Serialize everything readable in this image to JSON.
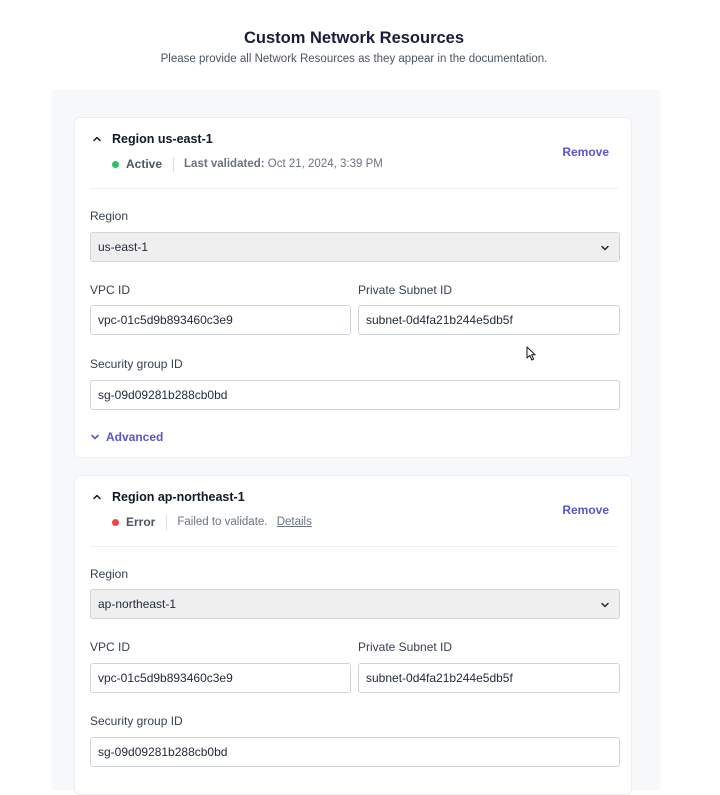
{
  "header": {
    "title": "Custom Network Resources",
    "subtitle": "Please provide all Network Resources as they appear in the documentation."
  },
  "colors": {
    "accent": "#5856c9",
    "status_active": "#22c55e",
    "status_error": "#ef4444"
  },
  "regions": [
    {
      "title": "Region us-east-1",
      "status": "Active",
      "status_color": "#22c55e",
      "last_validated_label": "Last validated:",
      "last_validated_value": "Oct 21, 2024, 3:39 PM",
      "remove_label": "Remove",
      "region_label": "Region",
      "region_value": "us-east-1",
      "vpc_label": "VPC ID",
      "vpc_value": "vpc-01c5d9b893460c3e9",
      "subnet_label": "Private Subnet ID",
      "subnet_value": "subnet-0d4fa21b244e5db5f",
      "sg_label": "Security group ID",
      "sg_value": "sg-09d09281b288cb0bd",
      "advanced_label": "Advanced"
    },
    {
      "title": "Region ap-northeast-1",
      "status": "Error",
      "status_color": "#ef4444",
      "error_message": "Failed to validate.",
      "details_label": "Details",
      "remove_label": "Remove",
      "region_label": "Region",
      "region_value": "ap-northeast-1",
      "vpc_label": "VPC ID",
      "vpc_value": "vpc-01c5d9b893460c3e9",
      "subnet_label": "Private Subnet ID",
      "subnet_value": "subnet-0d4fa21b244e5db5f",
      "sg_label": "Security group ID",
      "sg_value": "sg-09d09281b288cb0bd"
    }
  ]
}
